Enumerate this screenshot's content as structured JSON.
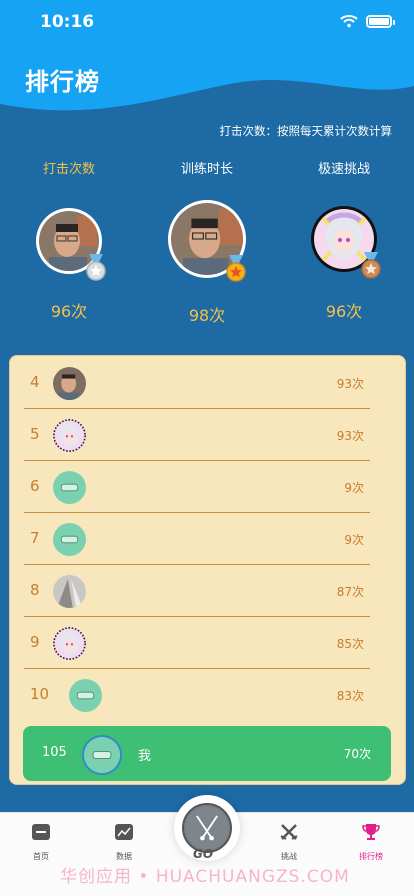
{
  "status": {
    "time": "10:16"
  },
  "header": {
    "title": "排行榜"
  },
  "hint": "打击次数：按照每天累计次数计算",
  "tabs": [
    {
      "label": "打击次数",
      "active": true
    },
    {
      "label": "训练时长",
      "active": false
    },
    {
      "label": "极速挑战",
      "active": false
    }
  ],
  "podium": [
    {
      "place": 2,
      "score": "96次",
      "avatar": "face-photo",
      "medal": "silver-medal-icon"
    },
    {
      "place": 1,
      "score": "98次",
      "avatar": "face-photo",
      "medal": "gold-medal-icon"
    },
    {
      "place": 3,
      "score": "96次",
      "avatar": "anime-photo",
      "medal": "bronze-medal-icon"
    }
  ],
  "ranking": [
    {
      "rank": "4",
      "score": "93次",
      "avatar": "face"
    },
    {
      "rank": "5",
      "score": "93次",
      "avatar": "anime"
    },
    {
      "rank": "6",
      "score": "9次",
      "avatar": "drum"
    },
    {
      "rank": "7",
      "score": "9次",
      "avatar": "drum"
    },
    {
      "rank": "8",
      "score": "87次",
      "avatar": "paper"
    },
    {
      "rank": "9",
      "score": "85次",
      "avatar": "anime"
    },
    {
      "rank": "10",
      "score": "83次",
      "avatar": "drum"
    }
  ],
  "me": {
    "rank": "105",
    "name": "我",
    "score": "70次"
  },
  "tabbar": [
    {
      "label": "首页",
      "icon": "home-icon",
      "active": false
    },
    {
      "label": "数据",
      "icon": "chart-icon",
      "active": false
    },
    {
      "label": "挑战",
      "icon": "swords-icon",
      "active": false
    },
    {
      "label": "排行榜",
      "icon": "trophy-icon",
      "active": true
    }
  ],
  "center_logo": "GO",
  "watermark": "华创应用 • HUACHUANGZS.COM",
  "colors": {
    "header": "#1aa6f2",
    "background": "#1d6aa5",
    "gold": "#f2c14a",
    "panel": "#f8e7bd",
    "me_row": "#3fbf73",
    "active_tab": "#e0208b"
  }
}
